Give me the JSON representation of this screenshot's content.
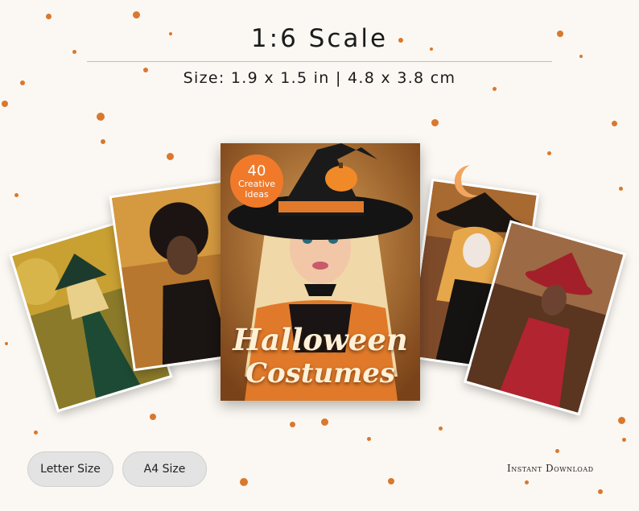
{
  "header": {
    "title": "1:6 Scale",
    "subtitle": "Size: 1.9 x 1.5 in | 4.8 x 3.8 cm"
  },
  "cover": {
    "badge_number": "40",
    "badge_line1": "Creative",
    "badge_line2": "Ideas",
    "title_line1": "Halloween",
    "title_line2": "Costumes"
  },
  "size_buttons": {
    "letter_label": "Letter Size",
    "a4_label": "A4 Size"
  },
  "footer": {
    "instant_download": "Instant Download"
  },
  "colors": {
    "accent": "#f07a2a",
    "dots": "#d9782e",
    "background": "#fbf8f3"
  }
}
